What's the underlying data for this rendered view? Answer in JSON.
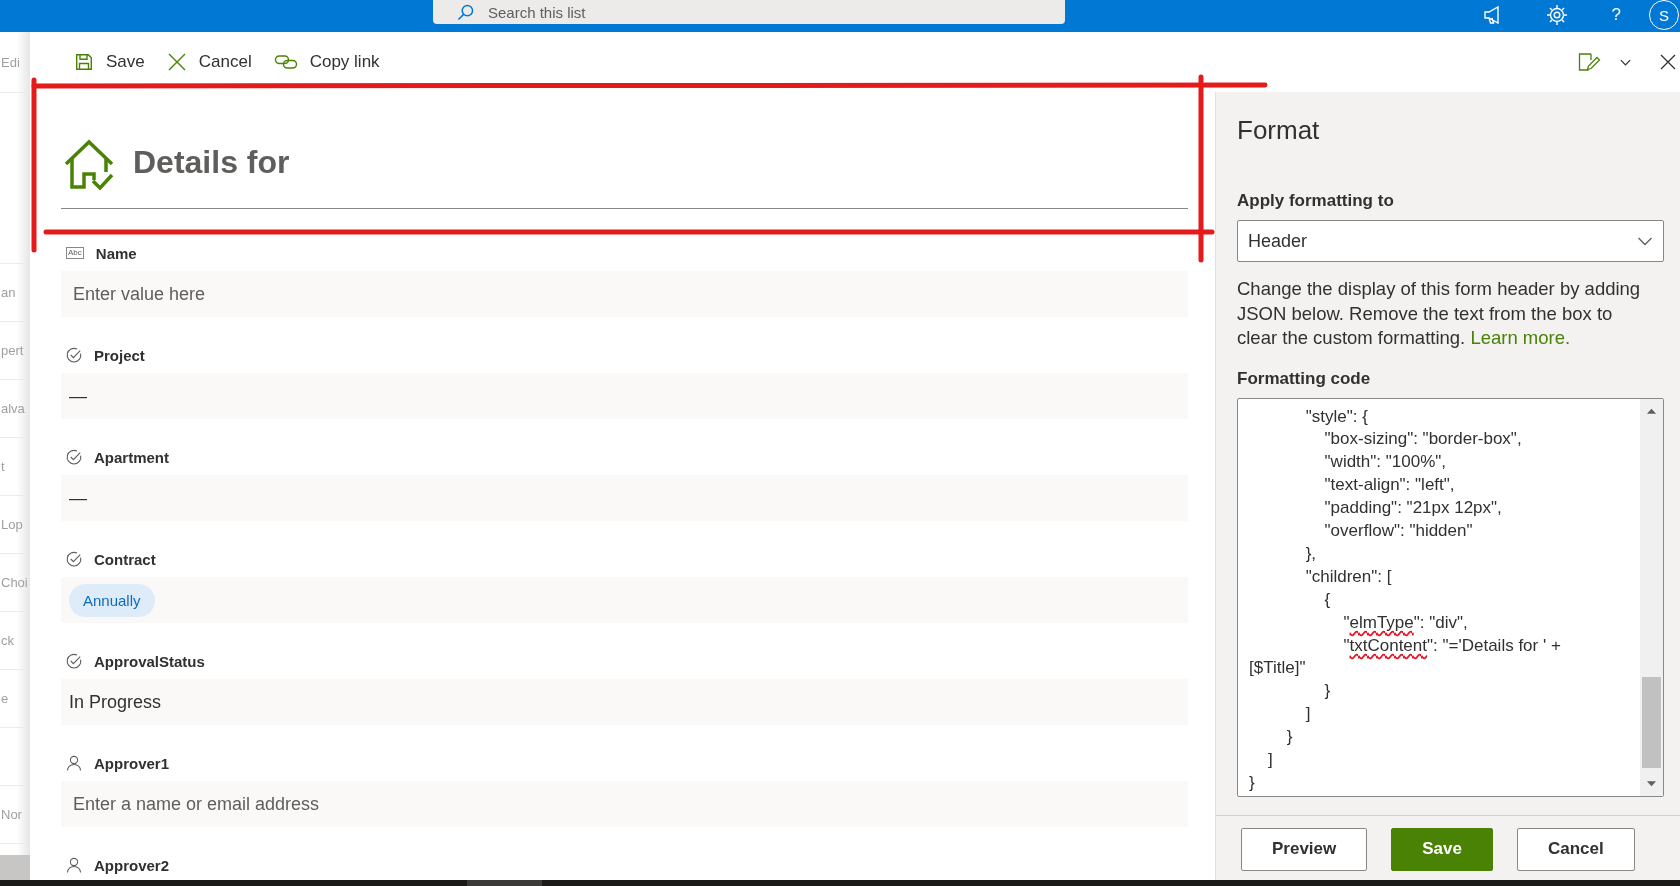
{
  "top_bar": {
    "search": {
      "placeholder": "Search this list"
    },
    "help": "?",
    "avatar_initial": "S"
  },
  "background_list": {
    "toolbar_text": "Edi",
    "rows": [
      {
        "text": "an"
      },
      {
        "text": "pert"
      },
      {
        "text": "alva"
      },
      {
        "text": "t"
      },
      {
        "text": "Lop"
      },
      {
        "text": "Choi"
      },
      {
        "text": "ck"
      },
      {
        "text": "e"
      },
      {},
      {
        "text": "Nor"
      }
    ]
  },
  "command_bar": {
    "actions": [
      {
        "kind": "save",
        "label": "Save"
      },
      {
        "kind": "cancel",
        "label": "Cancel"
      },
      {
        "kind": "copy_link",
        "label": "Copy link"
      }
    ]
  },
  "form": {
    "header": {
      "title": "Details for"
    },
    "fields": [
      {
        "kind": "text",
        "type_icon_text": "Abc",
        "label": "Name",
        "placeholder": "Enter value here"
      },
      {
        "kind": "choice",
        "label": "Project",
        "value": "—"
      },
      {
        "kind": "choice",
        "label": "Apartment",
        "value": "—"
      },
      {
        "kind": "choice",
        "label": "Contract",
        "chips": [
          "Annually"
        ]
      },
      {
        "kind": "choice",
        "label": "ApprovalStatus",
        "value": "In Progress"
      },
      {
        "kind": "person",
        "label": "Approver1",
        "placeholder": "Enter a name or email address"
      },
      {
        "kind": "person",
        "label": "Approver2"
      }
    ]
  },
  "format_pane": {
    "title": "Format",
    "apply_label": "Apply formatting to",
    "apply_value": "Header",
    "description": "Change the display of this form header by adding JSON below. Remove the text from the box to clear the custom formatting.",
    "learn_more": "Learn more.",
    "code_label": "Formatting code",
    "code_lines": [
      {
        "spans": [
          {
            "text": "            \"style\": {",
            "misspelled": false
          }
        ]
      },
      {
        "spans": [
          {
            "text": "                \"box-sizing\": \"border-box\",",
            "misspelled": false
          }
        ]
      },
      {
        "spans": [
          {
            "text": "                \"width\": \"100%\",",
            "misspelled": false
          }
        ]
      },
      {
        "spans": [
          {
            "text": "                \"text-align\": \"left\",",
            "misspelled": false
          }
        ]
      },
      {
        "spans": [
          {
            "text": "                \"padding\": \"21px 12px\",",
            "misspelled": false
          }
        ]
      },
      {
        "spans": [
          {
            "text": "                \"overflow\": \"hidden\"",
            "misspelled": false
          }
        ]
      },
      {
        "spans": [
          {
            "text": "            },",
            "misspelled": false
          }
        ]
      },
      {
        "spans": [
          {
            "text": "            \"children\": [",
            "misspelled": false
          }
        ]
      },
      {
        "spans": [
          {
            "text": "                {",
            "misspelled": false
          }
        ]
      },
      {
        "spans": [
          {
            "text": "                    \"",
            "misspelled": false
          },
          {
            "text": "elmType",
            "misspelled": true
          },
          {
            "text": "\": \"div\",",
            "misspelled": false
          }
        ]
      },
      {
        "spans": [
          {
            "text": "                    \"",
            "misspelled": false
          },
          {
            "text": "txtContent",
            "misspelled": true
          },
          {
            "text": "\": \"='Details for ' +",
            "misspelled": false
          }
        ]
      },
      {
        "spans": [
          {
            "text": "[$Title]\"",
            "misspelled": false
          }
        ]
      },
      {
        "spans": [
          {
            "text": "                }",
            "misspelled": false
          }
        ]
      },
      {
        "spans": [
          {
            "text": "            ]",
            "misspelled": false
          }
        ]
      },
      {
        "spans": [
          {
            "text": "        }",
            "misspelled": false
          }
        ]
      },
      {
        "spans": [
          {
            "text": "    ]",
            "misspelled": false
          }
        ]
      },
      {
        "spans": [
          {
            "text": "}",
            "misspelled": false
          }
        ]
      }
    ],
    "buttons": [
      {
        "kind": "preview",
        "label": "Preview"
      },
      {
        "kind": "save",
        "label": "Save"
      },
      {
        "kind": "cancel",
        "label": "Cancel"
      }
    ]
  }
}
